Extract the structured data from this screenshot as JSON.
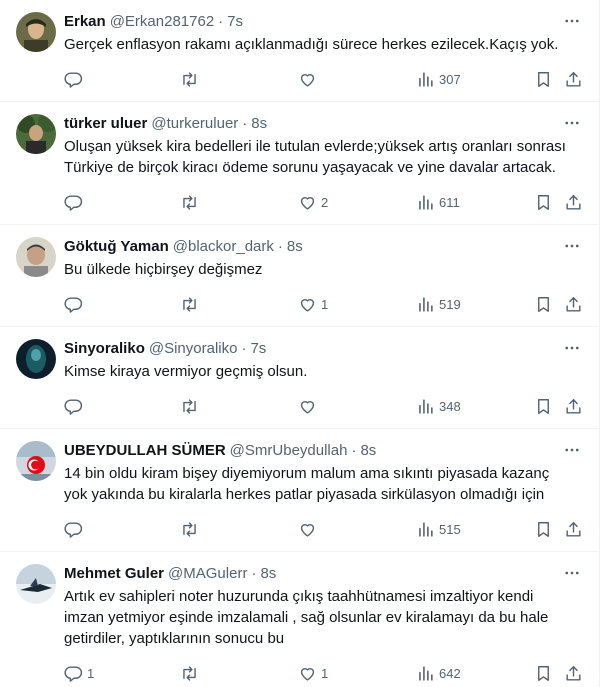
{
  "colors": {
    "text": "#0f1419",
    "muted": "#536471",
    "divider": "#eff3f4",
    "background": "#ffffff"
  },
  "icons": {
    "reply": "reply-icon",
    "retweet": "retweet-icon",
    "like": "like-icon",
    "views": "views-icon",
    "bookmark": "bookmark-icon",
    "share": "share-icon",
    "more": "more-icon"
  },
  "tweets": [
    {
      "name": "Erkan",
      "handle": "@Erkan281762",
      "dot": "·",
      "time": "7s",
      "text": "Gerçek enflasyon rakamı açıklanmadığı sürece herkes ezilecek.Kaçış yok.",
      "replies": "",
      "retweets": "",
      "likes": "",
      "views": "307"
    },
    {
      "name": "türker uluer",
      "handle": "@turkeruluer",
      "dot": "·",
      "time": "8s",
      "text": "Oluşan yüksek kira bedelleri ile tutulan evlerde;yüksek artış oranları sonrası\nTürkiye de birçok kiracı ödeme sorunu yaşayacak ve yine davalar artacak.",
      "replies": "",
      "retweets": "",
      "likes": "2",
      "views": "611"
    },
    {
      "name": "Göktuğ Yaman",
      "handle": "@blackor_dark",
      "dot": "·",
      "time": "8s",
      "text": "Bu ülkede hiçbirşey değişmez",
      "replies": "",
      "retweets": "",
      "likes": "1",
      "views": "519"
    },
    {
      "name": "Sinyoraliko",
      "handle": "@Sinyoraliko",
      "dot": "·",
      "time": "7s",
      "text": "Kimse kiraya vermiyor geçmiş olsun.",
      "replies": "",
      "retweets": "",
      "likes": "",
      "views": "348"
    },
    {
      "name": "UBEYDULLAH SÜMER",
      "handle": "@SmrUbeydullah",
      "dot": "·",
      "time": "8s",
      "text": "14 bin oldu kiram bişey diyemiyorum malum ama sıkıntı piyasada kazanç\nyok yakında bu kiralarla herkes patlar piyasada sirkülasyon olmadığı için",
      "replies": "",
      "retweets": "",
      "likes": "",
      "views": "515"
    },
    {
      "name": "Mehmet Guler",
      "handle": "@MAGulerr",
      "dot": "·",
      "time": "8s",
      "text": "Artık ev sahipleri noter huzurunda çıkış taahhütnamesi imzaltiyor kendi\nimzan yetmiyor eşinde imzalamali , sağ olsunlar ev kiralamayı da bu hale\ngetirdiler, yaptıklarının sonucu bu",
      "replies": "1",
      "retweets": "",
      "likes": "1",
      "views": "642"
    }
  ]
}
